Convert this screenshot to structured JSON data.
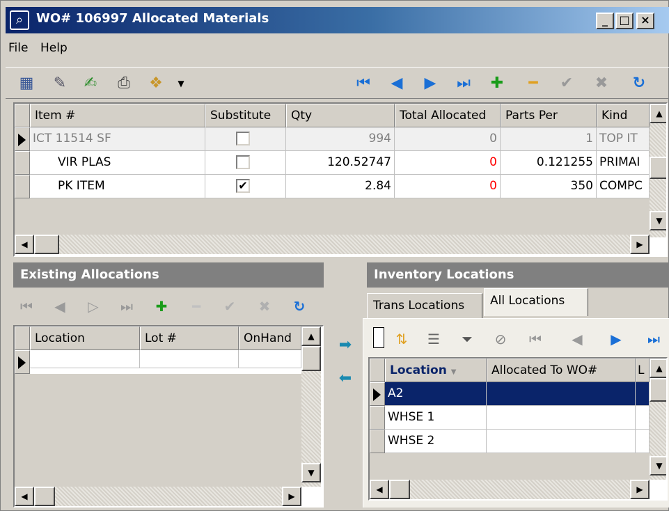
{
  "window": {
    "title": "WO# 106997 Allocated Materials",
    "minimize": "_",
    "maximize": "□",
    "close": "×"
  },
  "menu": {
    "file": "File",
    "help": "Help"
  },
  "items_grid": {
    "columns": [
      "Item #",
      "Substitute",
      "Qty",
      "Total Allocated",
      "Parts Per",
      "Kind"
    ],
    "rows": [
      {
        "item": "ICT 11514 SF",
        "substitute": "",
        "qty": "994",
        "total_allocated": "0",
        "parts_per": "1",
        "kind": "TOP IT"
      },
      {
        "item": "VIR PLAS",
        "substitute": "",
        "qty": "120.52747",
        "total_allocated": "0",
        "parts_per": "0.121255",
        "kind": "PRIMAI"
      },
      {
        "item": "PK ITEM",
        "substitute": "✔",
        "qty": "2.84",
        "total_allocated": "0",
        "parts_per": "350",
        "kind": "COMPC"
      }
    ]
  },
  "existing_allocations": {
    "title": "Existing Allocations",
    "columns": [
      "Location",
      "Lot #",
      "OnHand"
    ]
  },
  "inventory_locations": {
    "title": "Inventory Locations",
    "tabs": [
      "Trans Locations",
      "All Locations"
    ],
    "columns": [
      "Location",
      "Allocated To WO#",
      "L"
    ],
    "rows": [
      "A2",
      "WHSE 1",
      "WHSE 2"
    ]
  },
  "colors": {
    "title_bar": "#0a246a",
    "selected_row": "#0a246a",
    "allocated_zero": "#ff0000",
    "nav_blue": "#1a6fd6",
    "add_green": "#1a9c1a"
  }
}
